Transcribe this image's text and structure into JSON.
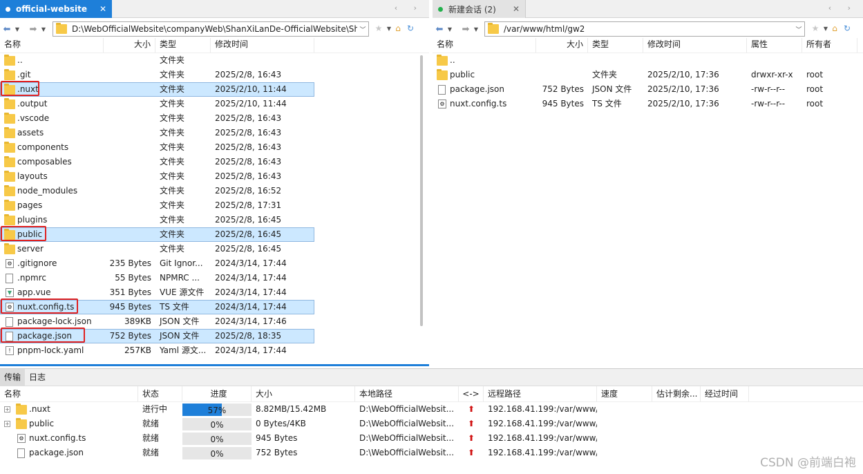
{
  "left": {
    "tab_label": "official-website",
    "path": "D:\\WebOfficialWebsite\\companyWeb\\ShanXiLanDe-OfficialWebsite\\Sha",
    "columns": {
      "name": "名称",
      "size": "大小",
      "type": "类型",
      "mtime": "修改时间"
    },
    "files": [
      {
        "name": "..",
        "size": "",
        "type": "文件夹",
        "mtime": "",
        "icon": "folder-icon",
        "selected": false,
        "marked": false
      },
      {
        "name": ".git",
        "size": "",
        "type": "文件夹",
        "mtime": "2025/2/8, 16:43",
        "icon": "folder-icon",
        "selected": false,
        "marked": false
      },
      {
        "name": ".nuxt",
        "size": "",
        "type": "文件夹",
        "mtime": "2025/2/10, 11:44",
        "icon": "folder-icon",
        "selected": true,
        "marked": true
      },
      {
        "name": ".output",
        "size": "",
        "type": "文件夹",
        "mtime": "2025/2/10, 11:44",
        "icon": "folder-icon",
        "selected": false,
        "marked": false
      },
      {
        "name": ".vscode",
        "size": "",
        "type": "文件夹",
        "mtime": "2025/2/8, 16:43",
        "icon": "folder-icon",
        "selected": false,
        "marked": false
      },
      {
        "name": "assets",
        "size": "",
        "type": "文件夹",
        "mtime": "2025/2/8, 16:43",
        "icon": "folder-icon",
        "selected": false,
        "marked": false
      },
      {
        "name": "components",
        "size": "",
        "type": "文件夹",
        "mtime": "2025/2/8, 16:43",
        "icon": "folder-icon",
        "selected": false,
        "marked": false
      },
      {
        "name": "composables",
        "size": "",
        "type": "文件夹",
        "mtime": "2025/2/8, 16:43",
        "icon": "folder-icon",
        "selected": false,
        "marked": false
      },
      {
        "name": "layouts",
        "size": "",
        "type": "文件夹",
        "mtime": "2025/2/8, 16:43",
        "icon": "folder-icon",
        "selected": false,
        "marked": false
      },
      {
        "name": "node_modules",
        "size": "",
        "type": "文件夹",
        "mtime": "2025/2/8, 16:52",
        "icon": "folder-icon",
        "selected": false,
        "marked": false
      },
      {
        "name": "pages",
        "size": "",
        "type": "文件夹",
        "mtime": "2025/2/8, 17:31",
        "icon": "folder-icon",
        "selected": false,
        "marked": false
      },
      {
        "name": "plugins",
        "size": "",
        "type": "文件夹",
        "mtime": "2025/2/8, 16:45",
        "icon": "folder-icon",
        "selected": false,
        "marked": false
      },
      {
        "name": "public",
        "size": "",
        "type": "文件夹",
        "mtime": "2025/2/8, 16:45",
        "icon": "folder-icon",
        "selected": true,
        "marked": true
      },
      {
        "name": "server",
        "size": "",
        "type": "文件夹",
        "mtime": "2025/2/8, 16:45",
        "icon": "folder-icon",
        "selected": false,
        "marked": false
      },
      {
        "name": ".gitignore",
        "size": "235 Bytes",
        "type": "Git Ignor...",
        "mtime": "2024/3/14, 17:44",
        "icon": "settings-file-icon",
        "selected": false,
        "marked": false
      },
      {
        "name": ".npmrc",
        "size": "55 Bytes",
        "type": "NPMRC ...",
        "mtime": "2024/3/14, 17:44",
        "icon": "file-icon",
        "selected": false,
        "marked": false
      },
      {
        "name": "app.vue",
        "size": "351 Bytes",
        "type": "VUE 源文件",
        "mtime": "2024/3/14, 17:44",
        "icon": "vue-file-icon",
        "selected": false,
        "marked": false
      },
      {
        "name": "nuxt.config.ts",
        "size": "945 Bytes",
        "type": "TS 文件",
        "mtime": "2024/3/14, 17:44",
        "icon": "ts-file-icon",
        "selected": true,
        "marked": true
      },
      {
        "name": "package-lock.json",
        "size": "389KB",
        "type": "JSON 文件",
        "mtime": "2024/3/14, 17:46",
        "icon": "file-icon",
        "selected": false,
        "marked": false
      },
      {
        "name": "package.json",
        "size": "752 Bytes",
        "type": "JSON 文件",
        "mtime": "2025/2/8, 18:35",
        "icon": "file-icon",
        "selected": true,
        "marked": true
      },
      {
        "name": "pnpm-lock.yaml",
        "size": "257KB",
        "type": "Yaml 源文...",
        "mtime": "2024/3/14, 17:44",
        "icon": "yaml-file-icon",
        "selected": false,
        "marked": false
      }
    ]
  },
  "right": {
    "tab_label": "新建会话 (2)",
    "path": "/var/www/html/gw2",
    "columns": {
      "name": "名称",
      "size": "大小",
      "type": "类型",
      "mtime": "修改时间",
      "attr": "属性",
      "owner": "所有者"
    },
    "files": [
      {
        "name": "..",
        "size": "",
        "type": "",
        "mtime": "",
        "attr": "",
        "owner": "",
        "icon": "folder-icon"
      },
      {
        "name": "public",
        "size": "",
        "type": "文件夹",
        "mtime": "2025/2/10, 17:36",
        "attr": "drwxr-xr-x",
        "owner": "root",
        "icon": "folder-icon"
      },
      {
        "name": "package.json",
        "size": "752 Bytes",
        "type": "JSON 文件",
        "mtime": "2025/2/10, 17:36",
        "attr": "-rw-r--r--",
        "owner": "root",
        "icon": "file-icon"
      },
      {
        "name": "nuxt.config.ts",
        "size": "945 Bytes",
        "type": "TS 文件",
        "mtime": "2025/2/10, 17:36",
        "attr": "-rw-r--r--",
        "owner": "root",
        "icon": "ts-file-icon"
      }
    ]
  },
  "bottom": {
    "tabs": [
      "传输",
      "日志"
    ],
    "columns": {
      "name": "名称",
      "status": "状态",
      "progress": "进度",
      "size": "大小",
      "local": "本地路径",
      "dir": "<->",
      "remote": "远程路径",
      "speed": "速度",
      "eta": "估计剩余...",
      "elapsed": "经过时间"
    },
    "transfers": [
      {
        "name": ".nuxt",
        "status": "进行中",
        "progress_label": "57%",
        "progress": 0.57,
        "size": "8.82MB/15.42MB",
        "local": "D:\\WebOfficialWebsit...",
        "remote": "192.168.41.199:/var/www/.",
        "icon": "folder-icon",
        "expandable": true
      },
      {
        "name": "public",
        "status": "就绪",
        "progress_label": "0%",
        "progress": 0,
        "size": "0 Bytes/4KB",
        "local": "D:\\WebOfficialWebsit...",
        "remote": "192.168.41.199:/var/www/.",
        "icon": "folder-icon",
        "expandable": true
      },
      {
        "name": "nuxt.config.ts",
        "status": "就绪",
        "progress_label": "0%",
        "progress": 0,
        "size": "945 Bytes",
        "local": "D:\\WebOfficialWebsit...",
        "remote": "192.168.41.199:/var/www/.",
        "icon": "ts-file-icon",
        "expandable": false
      },
      {
        "name": "package.json",
        "status": "就绪",
        "progress_label": "0%",
        "progress": 0,
        "size": "752 Bytes",
        "local": "D:\\WebOfficialWebsit...",
        "remote": "192.168.41.199:/var/www/.",
        "icon": "file-icon",
        "expandable": false
      }
    ]
  },
  "watermark": "CSDN @前端白袍",
  "colors": {
    "accent": "#1e7fd9",
    "selection": "#cce8ff",
    "marker": "#e02020",
    "folder": "#f7c948",
    "upload_arrow": "#d01010",
    "session_dot": "#22b14c"
  }
}
